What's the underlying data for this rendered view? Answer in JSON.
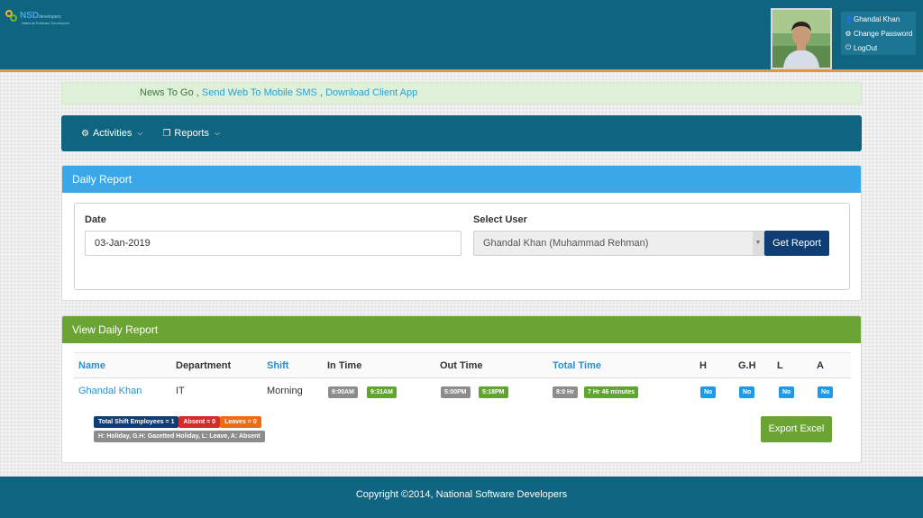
{
  "header": {
    "logo_text": "NSD",
    "logo_small": "developers",
    "logo_sub": "National Software Developers",
    "user_menu": [
      {
        "icon": "user-icon",
        "glyph": "👤",
        "label": "Ghandal Khan"
      },
      {
        "icon": "gear-icon",
        "glyph": "⚙",
        "label": "Change Password"
      },
      {
        "icon": "power-icon",
        "glyph": "⏻",
        "label": "LogOut"
      }
    ]
  },
  "news": {
    "lead": "News To Go",
    "sep1": " , ",
    "link1": "Send Web To Mobile SMS",
    "sep2": " , ",
    "link2": "Download Client App"
  },
  "nav": {
    "items": [
      {
        "label": "Activities",
        "icon": "cogs-icon"
      },
      {
        "label": "Reports",
        "icon": "copy-icon"
      }
    ]
  },
  "daily_report": {
    "title": "Daily Report",
    "date_label": "Date",
    "date_value": "03-Jan-2019",
    "user_label": "Select User",
    "user_value": "Ghandal Khan (Muhammad Rehman)",
    "button": "Get Report"
  },
  "view_report": {
    "title": "View Daily Report",
    "columns": [
      "Name",
      "Department",
      "Shift",
      "In Time",
      "Out Time",
      "Total Time",
      "H",
      "G.H",
      "L",
      "A"
    ],
    "row": {
      "name": "Ghandal Khan",
      "department": "IT",
      "shift": "Morning",
      "in_scheduled": "9:00AM",
      "in_actual": "9:31AM",
      "out_scheduled": "5:00PM",
      "out_actual": "5:18PM",
      "total_scheduled": "8:0 Hr",
      "total_actual": "7 Hr 46 minutes",
      "h": "No",
      "gh": "No",
      "l": "No",
      "a": "No"
    },
    "summary": {
      "total": "Total Shift Employees = 1",
      "absent": "Absent = 0",
      "leaves": "Leaves = 0",
      "legend": "H: Holiday, G.H: Gazetted Holiday, L: Leave, A: Absent"
    },
    "export_button": "Export Excel"
  },
  "footer": {
    "text": "Copyright ©2014, National Software Developers"
  },
  "colors": {
    "brand": "#0f6480",
    "accent_orange": "#e8943a",
    "daily_head": "#3aa8e8",
    "view_head": "#6aa534",
    "button_navy": "#0e3e73"
  }
}
